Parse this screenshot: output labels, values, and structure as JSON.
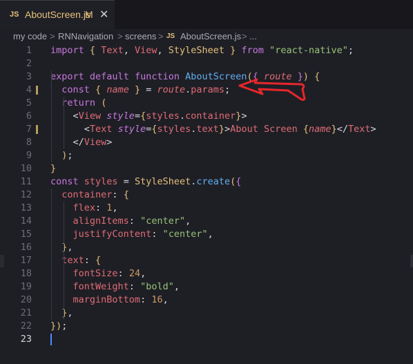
{
  "tab": {
    "badge": "JS",
    "name": "AboutScreen.js",
    "modified": "M",
    "close": "✕"
  },
  "breadcrumb": {
    "items": [
      "my code",
      "RNNavigation",
      "screens",
      "AboutScreen.js",
      "..."
    ],
    "separator": ">",
    "file_badge": "JS"
  },
  "editor": {
    "active_line": 23,
    "modified_lines": [
      4,
      7
    ],
    "line_numbers": [
      "1",
      "2",
      "3",
      "4",
      "5",
      "6",
      "7",
      "8",
      "9",
      "10",
      "11",
      "12",
      "13",
      "14",
      "15",
      "16",
      "17",
      "18",
      "19",
      "20",
      "21",
      "22",
      "23"
    ],
    "lines": [
      "import { Text, View, StyleSheet } from \"react-native\";",
      "",
      "export default function AboutScreen({ route }) {",
      "  const { name } = route.params;",
      "  return (",
      "    <View style={styles.container}>",
      "      <Text style={styles.text}>About Screen {name}</Text>",
      "    </View>",
      "  );",
      "}",
      "const styles = StyleSheet.create({",
      "  container: {",
      "    flex: 1,",
      "    alignItems: \"center\",",
      "    justifyContent: \"center\",",
      "  },",
      "  text: {",
      "    fontSize: 24,",
      "    fontWeight: \"bold\",",
      "    marginBottom: 16,",
      "  },",
      "});",
      ""
    ]
  },
  "annotation": {
    "color": "#e8262b",
    "icon": "red-arrow-icon",
    "points_to_line": 4
  }
}
